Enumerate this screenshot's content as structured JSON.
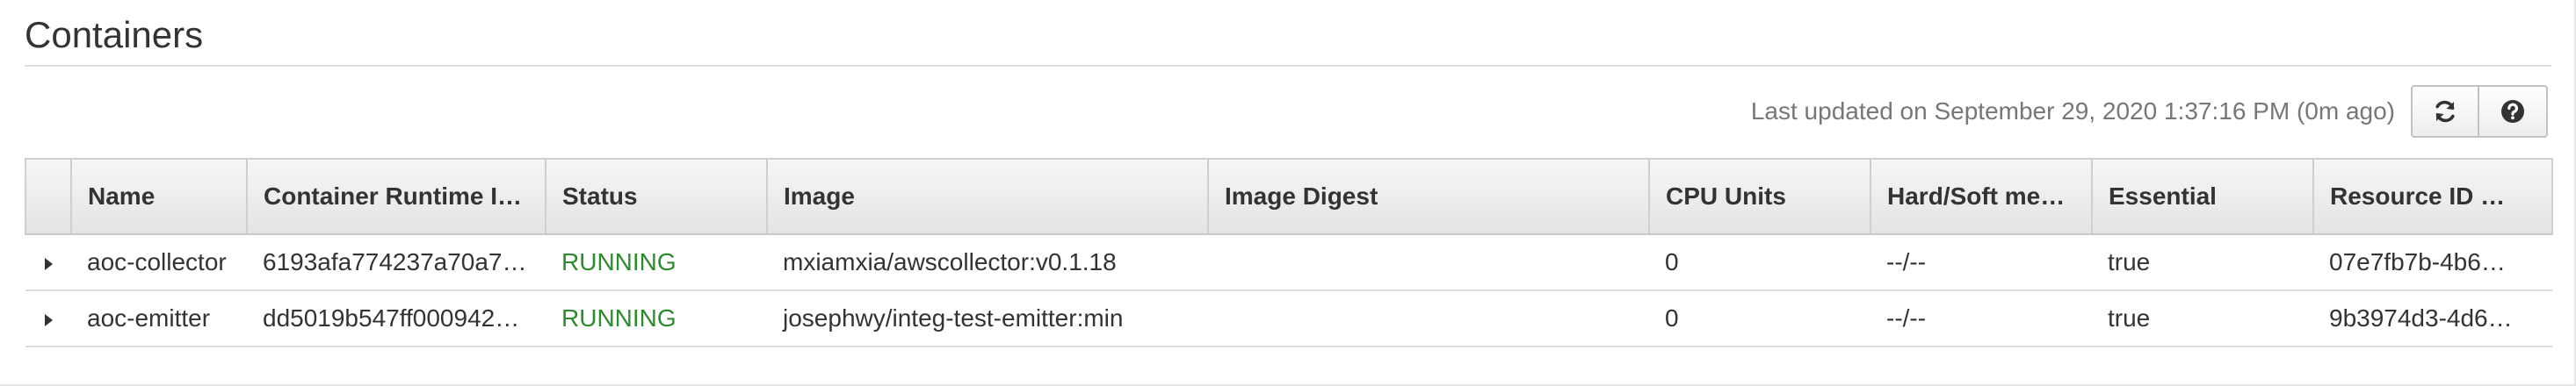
{
  "section": {
    "title": "Containers"
  },
  "toolbar": {
    "last_updated": "Last updated on September 29, 2020 1:37:16 PM (0m ago)",
    "refresh_icon": "refresh-icon",
    "help_icon": "help-icon"
  },
  "table": {
    "columns": [
      "Name",
      "Container Runtime I…",
      "Status",
      "Image",
      "Image Digest",
      "CPU Units",
      "Hard/Soft me…",
      "Essential",
      "Resource ID …"
    ],
    "rows": [
      {
        "name": "aoc-collector",
        "runtime_id": "6193afa774237a70a7…",
        "status": "RUNNING",
        "image": "mxiamxia/awscollector:v0.1.18",
        "image_digest": "",
        "cpu_units": "0",
        "memory": "--/--",
        "essential": "true",
        "resource_id": "07e7fb7b-4b6…"
      },
      {
        "name": "aoc-emitter",
        "runtime_id": "dd5019b547ff000942…",
        "status": "RUNNING",
        "image": "josephwy/integ-test-emitter:min",
        "image_digest": "",
        "cpu_units": "0",
        "memory": "--/--",
        "essential": "true",
        "resource_id": "9b3974d3-4d6…"
      }
    ]
  },
  "colors": {
    "status_running": "#2e8b2e",
    "header_bg": "#e9e9e9",
    "muted_text": "#777777"
  }
}
